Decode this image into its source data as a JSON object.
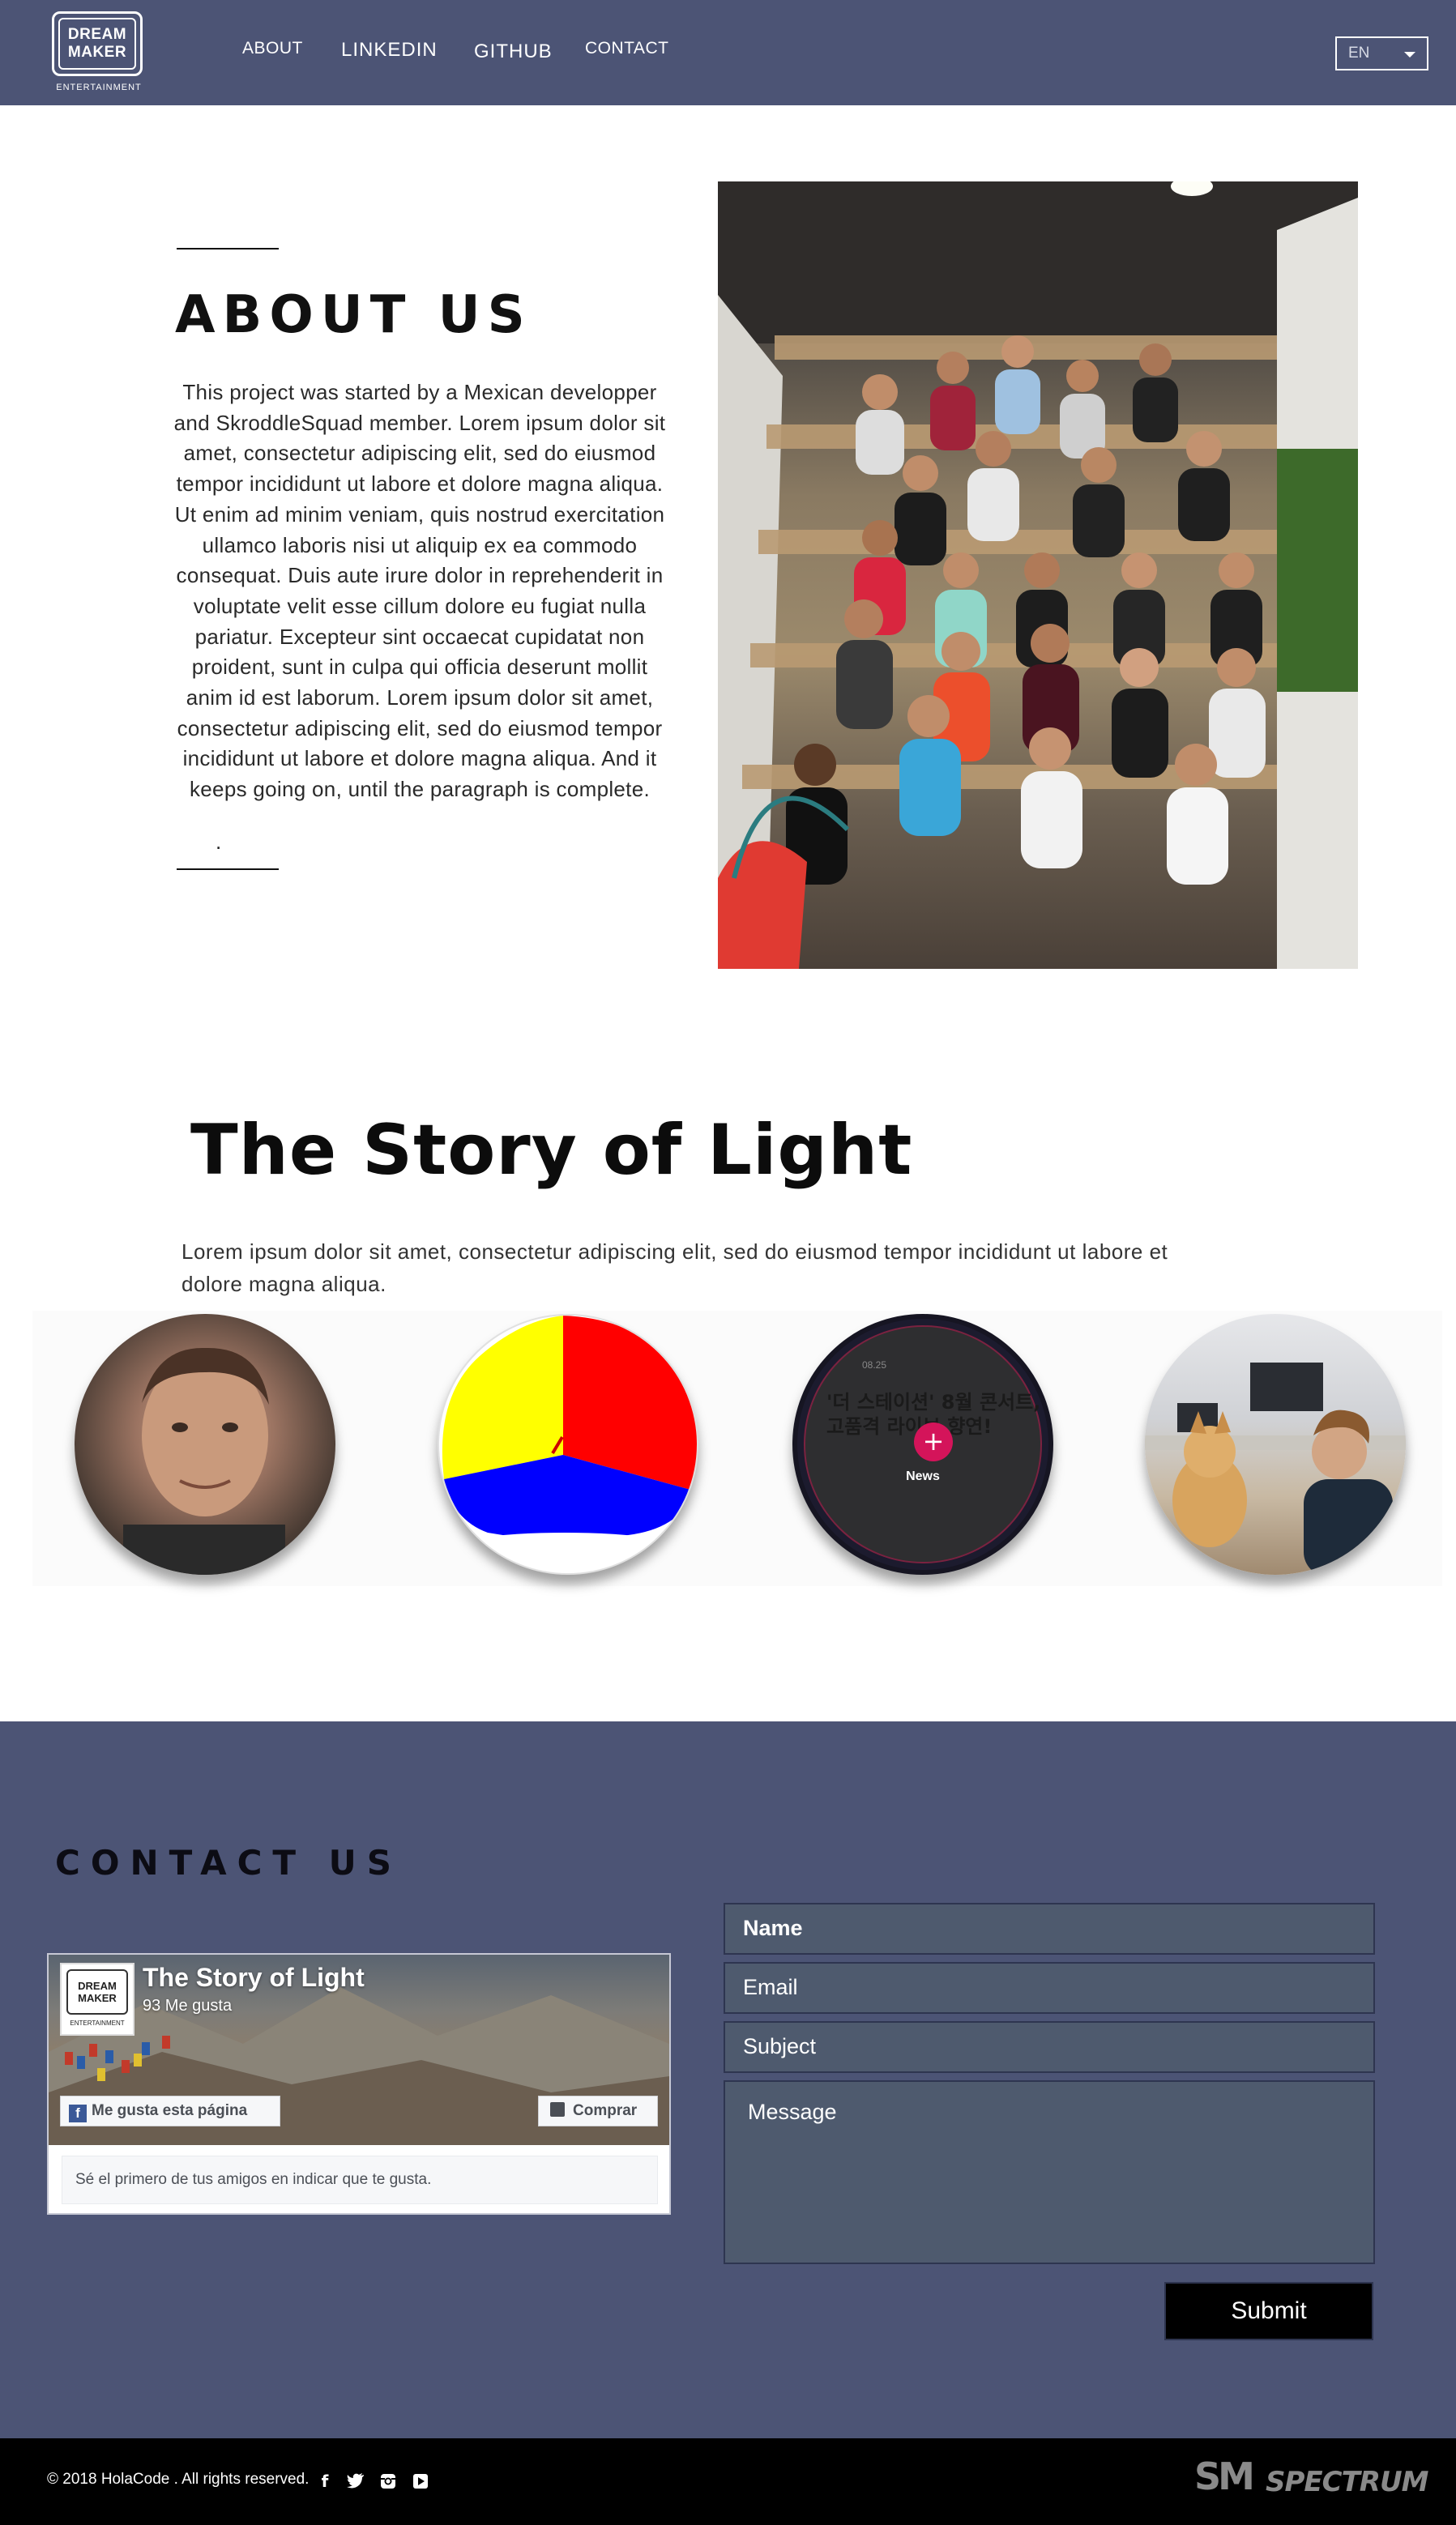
{
  "header": {
    "logo_line1": "DREAM",
    "logo_line2": "MAKER",
    "logo_sub": "ENTERTAINMENT",
    "nav": [
      "ABOUT",
      "LINKEDIN",
      "GITHUB",
      "CONTACT"
    ],
    "language": "EN",
    "colors": {
      "bar": "#4c5475"
    }
  },
  "about": {
    "title": "ABOUT US",
    "text": "This project was started by a Mexican developper and SkroddleSquad member. Lorem ipsum dolor sit amet, consectetur adipiscing elit, sed do eiusmod tempor incididunt ut labore et dolore magna aliqua. Ut enim ad minim veniam, quis nostrud exercitation ullamco laboris nisi ut aliquip ex ea commodo consequat. Duis aute irure dolor in reprehenderit in voluptate velit esse cillum dolore eu fugiat nulla pariatur. Excepteur sint occaecat cupidatat non proident, sunt in culpa qui officia deserunt mollit anim id est laborum. Lorem ipsum dolor sit amet, consectetur adipiscing elit, sed do eiusmod tempor incididunt ut labore et dolore magna aliqua. And it keeps going on, until the paragraph is complete.",
    "trailing": "."
  },
  "story": {
    "title": "The Story of Light",
    "text": "Lorem ipsum dolor sit amet, consectetur adipiscing elit, sed do eiusmod tempor incididunt ut labore et dolore magna aliqua.",
    "news_card": {
      "date": "08.25",
      "headline": "'더 스테이션' 8월 콘서트, 고품격 라이브 향연!",
      "label": "News",
      "plus": "+"
    }
  },
  "contact": {
    "title": "CONTACT US",
    "facebook": {
      "page_name": "The Story of Light",
      "likes": "93 Me gusta",
      "like_button": "Me gusta esta página",
      "buy_button": "Comprar",
      "footer_text": "Sé el primero de tus amigos en indicar que te gusta."
    },
    "form": {
      "name_placeholder": "Name",
      "email_placeholder": "Email",
      "subject_placeholder": "Subject",
      "message_placeholder": "Message",
      "submit_label": "Submit"
    },
    "colors": {
      "section": "#4c5475",
      "field": "#4e5a6e"
    }
  },
  "footer": {
    "copyright": "© 2018 HolaCode . All rights reserved.",
    "social_icons": [
      "facebook-icon",
      "twitter-icon",
      "instagram-icon",
      "youtube-icon"
    ],
    "sponsors": [
      "SM",
      "SPECTRUM"
    ]
  }
}
